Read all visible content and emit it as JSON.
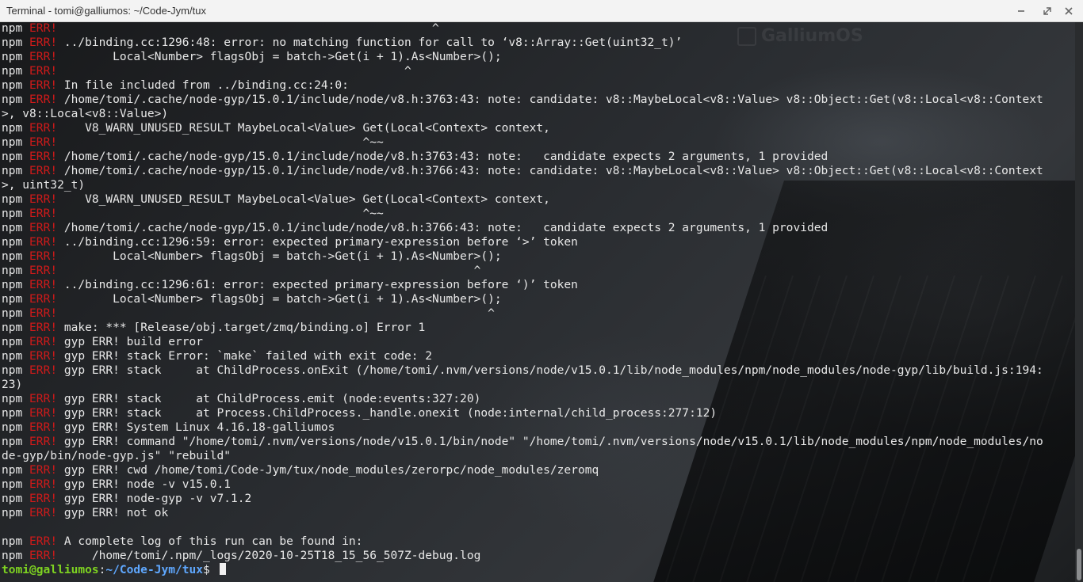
{
  "window": {
    "title": "Terminal - tomi@galliumos: ~/Code-Jym/tux",
    "controls": [
      "minimize-icon",
      "maximize-icon",
      "close-icon"
    ]
  },
  "wallpaper_watermark": "GalliumOS",
  "colors": {
    "err": "#d01a1a",
    "user": "#7ed321",
    "path": "#5fa8ff",
    "text": "#e8e8e8"
  },
  "terminal": {
    "lines": [
      {
        "prefix": "npm",
        "tag": "ERR!",
        "text": "                                                      ^"
      },
      {
        "prefix": "npm",
        "tag": "ERR!",
        "text": " ../binding.cc:1296:48: error: no matching function for call to ‘v8::Array::Get(uint32_t)’"
      },
      {
        "prefix": "npm",
        "tag": "ERR!",
        "text": "        Local<Number> flagsObj = batch->Get(i + 1).As<Number>();"
      },
      {
        "prefix": "npm",
        "tag": "ERR!",
        "text": "                                                  ^"
      },
      {
        "prefix": "npm",
        "tag": "ERR!",
        "text": " In file included from ../binding.cc:24:0:"
      },
      {
        "prefix": "npm",
        "tag": "ERR!",
        "text": " /home/tomi/.cache/node-gyp/15.0.1/include/node/v8.h:3763:43: note: candidate: v8::MaybeLocal<v8::Value> v8::Object::Get(v8::Local<v8::Context"
      },
      {
        "prefix": "",
        "tag": "",
        "text": ">, v8::Local<v8::Value>)"
      },
      {
        "prefix": "npm",
        "tag": "ERR!",
        "text": "    V8_WARN_UNUSED_RESULT MaybeLocal<Value> Get(Local<Context> context,"
      },
      {
        "prefix": "npm",
        "tag": "ERR!",
        "text": "                                            ^~~"
      },
      {
        "prefix": "npm",
        "tag": "ERR!",
        "text": " /home/tomi/.cache/node-gyp/15.0.1/include/node/v8.h:3763:43: note:   candidate expects 2 arguments, 1 provided"
      },
      {
        "prefix": "npm",
        "tag": "ERR!",
        "text": " /home/tomi/.cache/node-gyp/15.0.1/include/node/v8.h:3766:43: note: candidate: v8::MaybeLocal<v8::Value> v8::Object::Get(v8::Local<v8::Context"
      },
      {
        "prefix": "",
        "tag": "",
        "text": ">, uint32_t)"
      },
      {
        "prefix": "npm",
        "tag": "ERR!",
        "text": "    V8_WARN_UNUSED_RESULT MaybeLocal<Value> Get(Local<Context> context,"
      },
      {
        "prefix": "npm",
        "tag": "ERR!",
        "text": "                                            ^~~"
      },
      {
        "prefix": "npm",
        "tag": "ERR!",
        "text": " /home/tomi/.cache/node-gyp/15.0.1/include/node/v8.h:3766:43: note:   candidate expects 2 arguments, 1 provided"
      },
      {
        "prefix": "npm",
        "tag": "ERR!",
        "text": " ../binding.cc:1296:59: error: expected primary-expression before ‘>’ token"
      },
      {
        "prefix": "npm",
        "tag": "ERR!",
        "text": "        Local<Number> flagsObj = batch->Get(i + 1).As<Number>();"
      },
      {
        "prefix": "npm",
        "tag": "ERR!",
        "text": "                                                            ^"
      },
      {
        "prefix": "npm",
        "tag": "ERR!",
        "text": " ../binding.cc:1296:61: error: expected primary-expression before ‘)’ token"
      },
      {
        "prefix": "npm",
        "tag": "ERR!",
        "text": "        Local<Number> flagsObj = batch->Get(i + 1).As<Number>();"
      },
      {
        "prefix": "npm",
        "tag": "ERR!",
        "text": "                                                              ^"
      },
      {
        "prefix": "npm",
        "tag": "ERR!",
        "text": " make: *** [Release/obj.target/zmq/binding.o] Error 1"
      },
      {
        "prefix": "npm",
        "tag": "ERR!",
        "text": " gyp ERR! build error"
      },
      {
        "prefix": "npm",
        "tag": "ERR!",
        "text": " gyp ERR! stack Error: `make` failed with exit code: 2"
      },
      {
        "prefix": "npm",
        "tag": "ERR!",
        "text": " gyp ERR! stack     at ChildProcess.onExit (/home/tomi/.nvm/versions/node/v15.0.1/lib/node_modules/npm/node_modules/node-gyp/lib/build.js:194:"
      },
      {
        "prefix": "",
        "tag": "",
        "text": "23)"
      },
      {
        "prefix": "npm",
        "tag": "ERR!",
        "text": " gyp ERR! stack     at ChildProcess.emit (node:events:327:20)"
      },
      {
        "prefix": "npm",
        "tag": "ERR!",
        "text": " gyp ERR! stack     at Process.ChildProcess._handle.onexit (node:internal/child_process:277:12)"
      },
      {
        "prefix": "npm",
        "tag": "ERR!",
        "text": " gyp ERR! System Linux 4.16.18-galliumos"
      },
      {
        "prefix": "npm",
        "tag": "ERR!",
        "text": " gyp ERR! command \"/home/tomi/.nvm/versions/node/v15.0.1/bin/node\" \"/home/tomi/.nvm/versions/node/v15.0.1/lib/node_modules/npm/node_modules/no"
      },
      {
        "prefix": "",
        "tag": "",
        "text": "de-gyp/bin/node-gyp.js\" \"rebuild\""
      },
      {
        "prefix": "npm",
        "tag": "ERR!",
        "text": " gyp ERR! cwd /home/tomi/Code-Jym/tux/node_modules/zerorpc/node_modules/zeromq"
      },
      {
        "prefix": "npm",
        "tag": "ERR!",
        "text": " gyp ERR! node -v v15.0.1"
      },
      {
        "prefix": "npm",
        "tag": "ERR!",
        "text": " gyp ERR! node-gyp -v v7.1.2"
      },
      {
        "prefix": "npm",
        "tag": "ERR!",
        "text": " gyp ERR! not ok"
      },
      {
        "prefix": "",
        "tag": "",
        "text": ""
      },
      {
        "prefix": "npm",
        "tag": "ERR!",
        "text": " A complete log of this run can be found in:"
      },
      {
        "prefix": "npm",
        "tag": "ERR!",
        "text": "     /home/tomi/.npm/_logs/2020-10-25T18_15_56_507Z-debug.log"
      }
    ],
    "prompt": {
      "user_host": "tomi@galliumos",
      "separator": ":",
      "path": "~/Code-Jym/tux",
      "symbol": "$ "
    }
  }
}
